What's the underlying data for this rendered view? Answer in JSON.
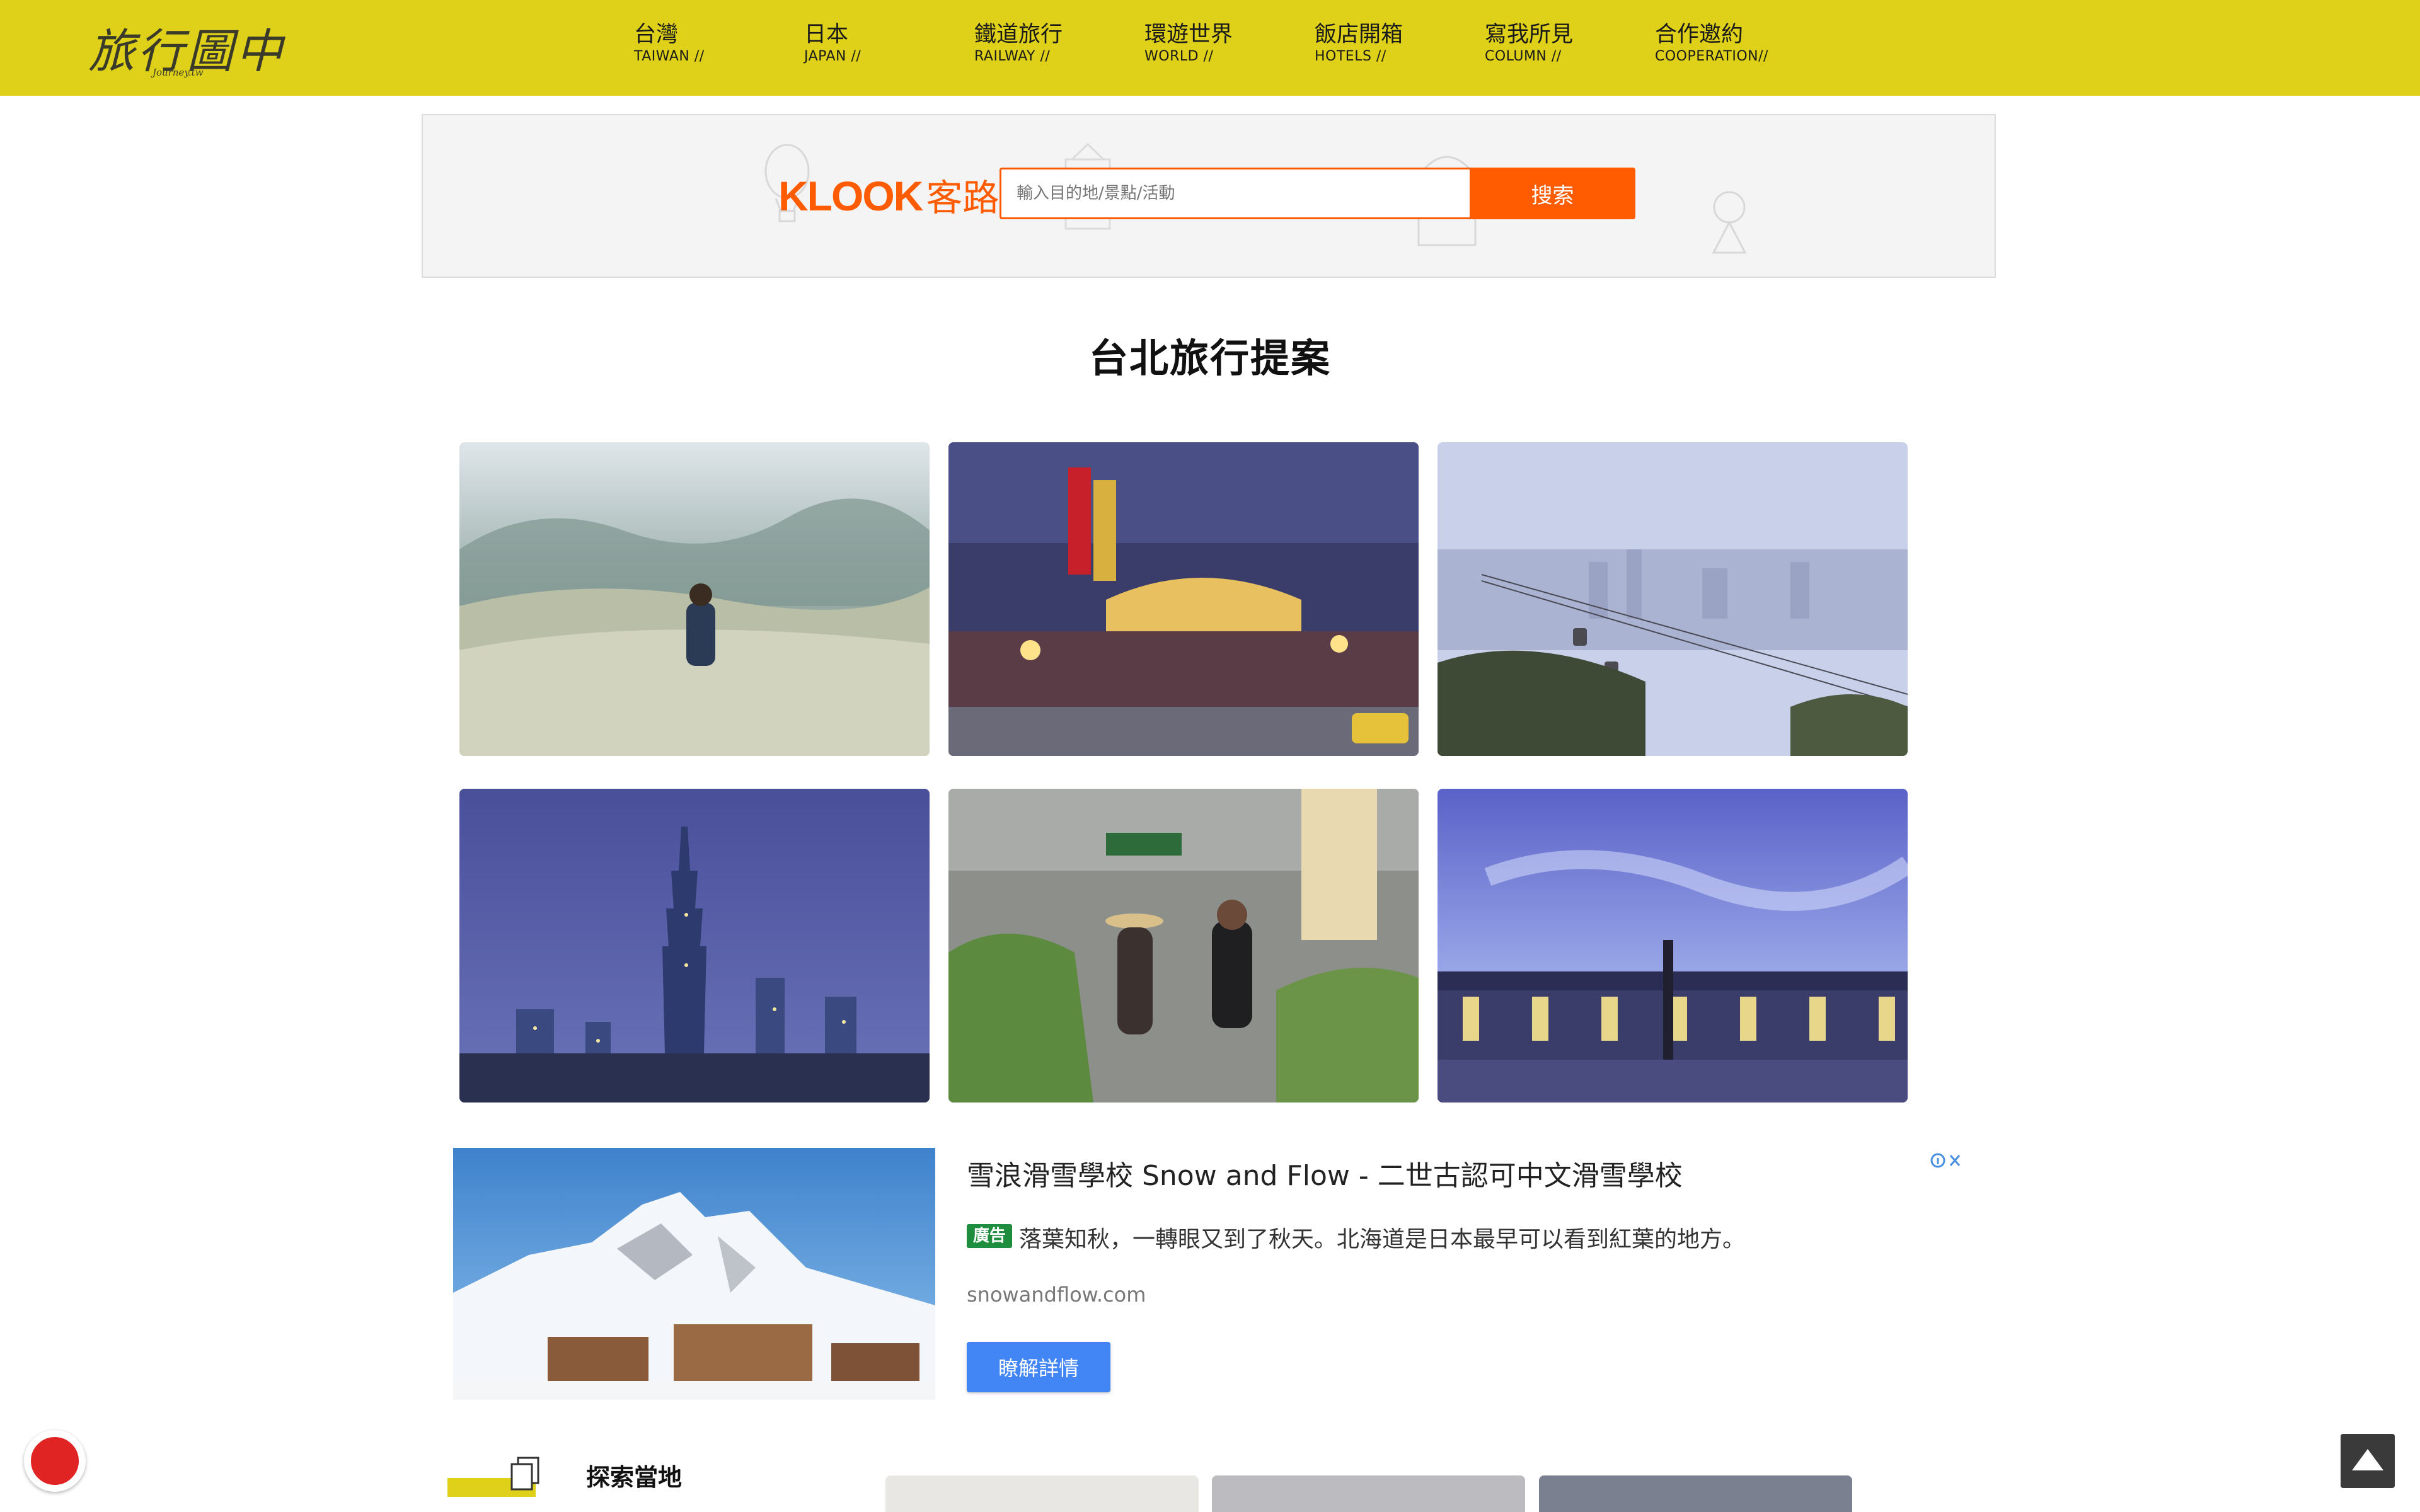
{
  "brand": {
    "name": "旅行圖中",
    "sub": "Journey.tw"
  },
  "nav": [
    {
      "zh": "台灣",
      "en": "TAIWAN //"
    },
    {
      "zh": "日本",
      "en": "JAPAN //"
    },
    {
      "zh": "鐵道旅行",
      "en": "RAILWAY //"
    },
    {
      "zh": "環遊世界",
      "en": "WORLD //"
    },
    {
      "zh": "飯店開箱",
      "en": "HOTELS //"
    },
    {
      "zh": "寫我所見",
      "en": "COLUMN //"
    },
    {
      "zh": "合作邀約",
      "en": "COOPERATION//"
    }
  ],
  "klook": {
    "brand": "KLOOK",
    "brand_zh": "客路",
    "placeholder": "輸入目的地/景點/活動",
    "search_label": "搜索",
    "accent": "#ff5b00"
  },
  "section": {
    "title": "台北旅行提案"
  },
  "photos": [
    {
      "subject": "silver grass hillside"
    },
    {
      "subject": "Raohe night market gate"
    },
    {
      "subject": "Maokong gondola city view"
    },
    {
      "subject": "Taipei 101 night skyline"
    },
    {
      "subject": "market vegetable stall"
    },
    {
      "subject": "twilight reflection pool"
    }
  ],
  "ad": {
    "title": "雪浪滑雪學校 Snow and Flow - 二世古認可中文滑雪學校",
    "badge": "廣告",
    "description": "落葉知秋，一轉眼又到了秋天。北海道是日本最早可以看到紅葉的地方。",
    "url": "snowandflow.com",
    "cta": "瞭解詳情",
    "cta_color": "#4285f4",
    "badge_color": "#1e8e3e"
  },
  "explore": {
    "title": "探索當地"
  },
  "colors": {
    "header": "#dfd019",
    "totop": "#3a3a3a",
    "notification": "#e02424"
  }
}
